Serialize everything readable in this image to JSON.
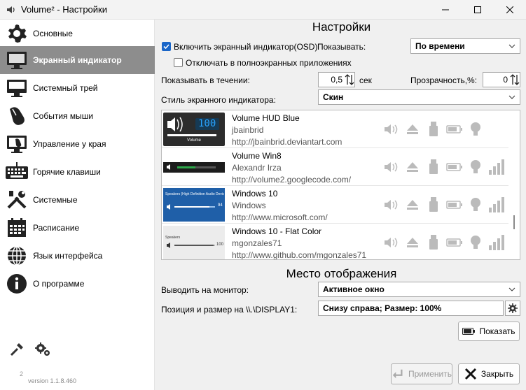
{
  "window": {
    "title": "Volume² - Настройки"
  },
  "sidebar": {
    "items": [
      {
        "label": "Основные",
        "icon": "gear-icon"
      },
      {
        "label": "Экранный индикатор",
        "icon": "monitor-icon"
      },
      {
        "label": "Системный трей",
        "icon": "tray-icon"
      },
      {
        "label": "События мыши",
        "icon": "mouse-icon"
      },
      {
        "label": "Управление у края",
        "icon": "screen-edge-icon"
      },
      {
        "label": "Горячие клавиши",
        "icon": "keyboard-icon"
      },
      {
        "label": "Системные",
        "icon": "tools-icon"
      },
      {
        "label": "Расписание",
        "icon": "calendar-icon"
      },
      {
        "label": "Язык интерфейса",
        "icon": "globe-icon"
      },
      {
        "label": "О программе",
        "icon": "info-icon"
      }
    ],
    "selected": "Экранный индикатор",
    "superscript": "2",
    "version": "version 1.1.8.460"
  },
  "settings": {
    "heading": "Настройки",
    "enable_osd_label": "Включить экранный индикатор(OSD)",
    "enable_osd_checked": true,
    "show_label": "Показывать:",
    "show_value": "По времени",
    "disable_fullscreen_label": "Отключать в полноэкранных приложениях",
    "disable_fullscreen_checked": false,
    "duration_label": "Показывать в течении:",
    "duration_value": "0,5",
    "duration_unit": "сек",
    "transparency_label": "Прозрачность,%:",
    "transparency_value": "0",
    "style_label": "Стиль экранного индикатора:",
    "style_value": "Скин"
  },
  "skins": [
    {
      "name": "Volume HUD Blue",
      "author": "jbainbrid",
      "url": "http://jbainbrid.deviantart.com",
      "preview_text": "100",
      "preview_caption": "Volume",
      "has_bars": false
    },
    {
      "name": "Volume Win8",
      "author": "Alexandr Irza",
      "url": "http://volume2.googlecode.com/",
      "preview_text": "",
      "preview_caption": "",
      "has_bars": true
    },
    {
      "name": "Windows 10",
      "author": "Windows",
      "url": "http://www.microsoft.com/",
      "preview_text": "94",
      "preview_caption": "Speakers (High Definition Audio Device)",
      "has_bars": true
    },
    {
      "name": "Windows 10 - Flat Color",
      "author": "mgonzales71",
      "url": "http://www.github.com/mgonzales71",
      "preview_text": "100",
      "preview_caption": "Speakers",
      "has_bars": true
    }
  ],
  "placement": {
    "heading": "Место отображения",
    "monitor_label": "Выводить на монитор:",
    "monitor_value": "Активное окно",
    "position_label": "Позиция и размер на \\\\.\\DISPLAY1:",
    "position_value": "Снизу справа; Размер: 100%",
    "show_button": "Показать"
  },
  "footer": {
    "apply_button": "Применить",
    "close_button": "Закрыть"
  },
  "colors": {
    "accent": "#1a66c8",
    "selected_bg": "#8d8d8d",
    "osd_blue": "#29a3ff"
  }
}
